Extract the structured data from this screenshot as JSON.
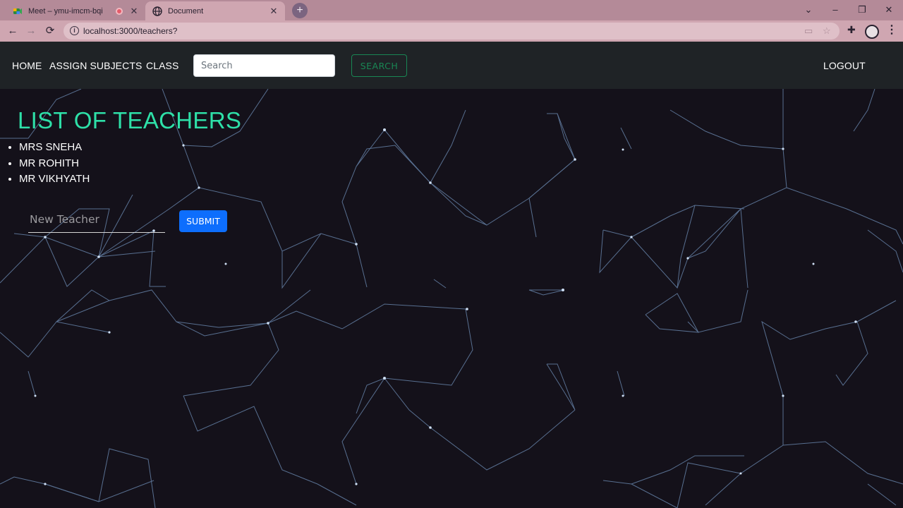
{
  "browser": {
    "tabs": [
      {
        "title": "Meet – ymu-imcm-bqi",
        "favicon": "google-meet-icon",
        "recording": true,
        "active": false
      },
      {
        "title": "Document",
        "favicon": "globe-icon",
        "active": true
      }
    ],
    "new_tab_label": "+",
    "window_controls": {
      "minimize": "–",
      "maximize": "❐",
      "close": "✕",
      "tab_search": "⌄"
    },
    "nav": {
      "back": "←",
      "forward": "→",
      "reload": "⟳"
    },
    "url": "localhost:3000/teachers?",
    "icons": [
      "info-icon",
      "star-icon",
      "puzzle-icon",
      "profile-icon",
      "kebab-menu-icon"
    ]
  },
  "navbar": {
    "links": [
      "HOME",
      "ASSIGN SUBJECTS",
      "CLASS"
    ],
    "search_placeholder": "Search",
    "search_button": "SEARCH",
    "logout": "LOGOUT"
  },
  "main": {
    "title": "LIST OF TEACHERS",
    "teachers": [
      "MRS SNEHA",
      "MR ROHITH",
      "MR VIKHYATH"
    ],
    "new_teacher_placeholder": "New Teacher",
    "submit_label": "SUBMIT"
  },
  "colors": {
    "title": "#2ee0a8",
    "navbar_bg": "#1f2326",
    "page_bg": "#14111a",
    "network_lines": "#6f8fb8",
    "search_button": "#198754",
    "submit_button": "#0d6efd",
    "browser_chrome": "#cfa6b1"
  }
}
